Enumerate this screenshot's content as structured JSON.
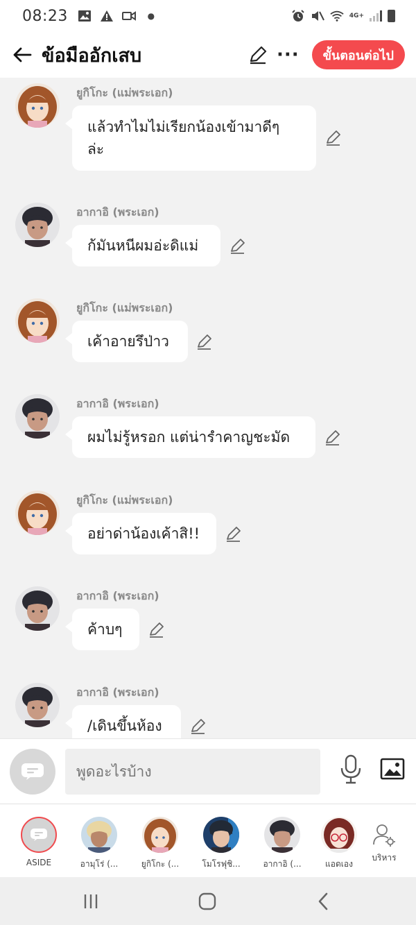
{
  "status_bar": {
    "time": "08:23",
    "network": "4G+"
  },
  "header": {
    "title": "ข้อมืออักเสบ",
    "next_button": "ขั้นตอนต่อไป"
  },
  "messages": [
    {
      "sender": "ยูกิโกะ (แม่พระเอก)",
      "text": "แล้วทำไมไม่เรียกน้องเข้ามาดีๆ ล่ะ",
      "avatar": "yukiko"
    },
    {
      "sender": "อากาอิ (พระเอก)",
      "text": "ก้มันหนีผมอ่ะดิแม่",
      "avatar": "akai"
    },
    {
      "sender": "ยูกิโกะ (แม่พระเอก)",
      "text": "เค้าอายรึป่าว",
      "avatar": "yukiko"
    },
    {
      "sender": "อากาอิ (พระเอก)",
      "text": "ผมไม่รู้หรอก แต่น่ารำคาญชะมัด",
      "avatar": "akai"
    },
    {
      "sender": "ยูกิโกะ (แม่พระเอก)",
      "text": "อย่าด่าน้องเค้าสิ!!",
      "avatar": "yukiko"
    },
    {
      "sender": "อากาอิ (พระเอก)",
      "text": "ค้าบๆ",
      "avatar": "akai"
    },
    {
      "sender": "อากาอิ (พระเอก)",
      "text": "/เดินขึ้นห้อง",
      "avatar": "akai"
    }
  ],
  "input": {
    "placeholder": "พูดอะไรบ้าง"
  },
  "characters": [
    {
      "label": "ASIDE"
    },
    {
      "label": "อามุโร่ (..."
    },
    {
      "label": "ยูกิโกะ (..."
    },
    {
      "label": "โมโรฟุชิ..."
    },
    {
      "label": "อากาอิ (..."
    },
    {
      "label": "แอดเอง"
    },
    {
      "label": "บริหาร"
    }
  ],
  "colors": {
    "accent": "#f44a4e",
    "bubble": "#ffffff",
    "background": "#f2f2f2"
  }
}
